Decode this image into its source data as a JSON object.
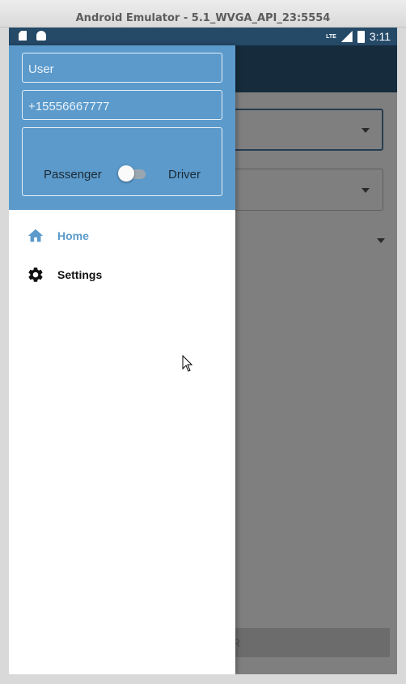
{
  "window": {
    "title": "Android Emulator - 5.1_WVGA_API_23:5554"
  },
  "status_bar": {
    "time": "3:11",
    "network": "LTE"
  },
  "drawer": {
    "user_field": {
      "value": "User"
    },
    "phone_field": {
      "value": "+15556667777"
    },
    "role_switch": {
      "left_label": "Passenger",
      "right_label": "Driver",
      "checked": false
    },
    "menu": [
      {
        "label": "Home",
        "icon": "home-icon",
        "selected": true
      },
      {
        "label": "Settings",
        "icon": "gear-icon",
        "selected": false
      }
    ]
  },
  "background_app": {
    "bottom_button_label": "R"
  },
  "colors": {
    "drawer_header": "#5b9acb",
    "toolbar": "#2c587a",
    "status_bar": "#254a68",
    "selected_text": "#5b9acb"
  }
}
